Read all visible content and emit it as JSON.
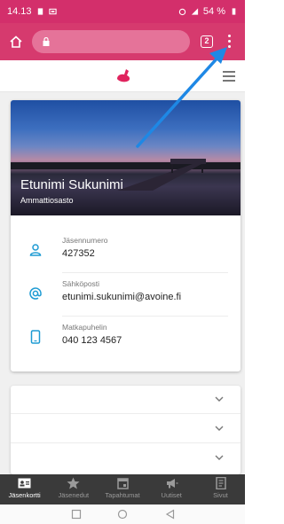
{
  "status_bar": {
    "time": "14.13",
    "battery": "54 %"
  },
  "browser": {
    "tab_count": "2"
  },
  "member_card": {
    "name": "Etunimi Sukunimi",
    "organization": "Ammattiosasto",
    "fields": [
      {
        "label": "Jäsennumero",
        "value": "427352",
        "icon": "person-icon"
      },
      {
        "label": "Sähköposti",
        "value": "etunimi.sukunimi@avoine.fi",
        "icon": "at-icon"
      },
      {
        "label": "Matkapuhelin",
        "value": "040 123 4567",
        "icon": "phone-icon"
      }
    ]
  },
  "bottom_nav": {
    "items": [
      {
        "label": "Jäsenkortti",
        "icon": "id-card-icon",
        "active": true
      },
      {
        "label": "Jäsenedut",
        "icon": "star-icon",
        "active": false
      },
      {
        "label": "Tapahtumat",
        "icon": "calendar-icon",
        "active": false
      },
      {
        "label": "Uutiset",
        "icon": "megaphone-icon",
        "active": false
      },
      {
        "label": "Sivut",
        "icon": "pages-icon",
        "active": false
      }
    ]
  },
  "colors": {
    "brand": "#d63a6e",
    "accent_blue": "#1e9bd3",
    "nav_bg": "#3a3a3a"
  }
}
